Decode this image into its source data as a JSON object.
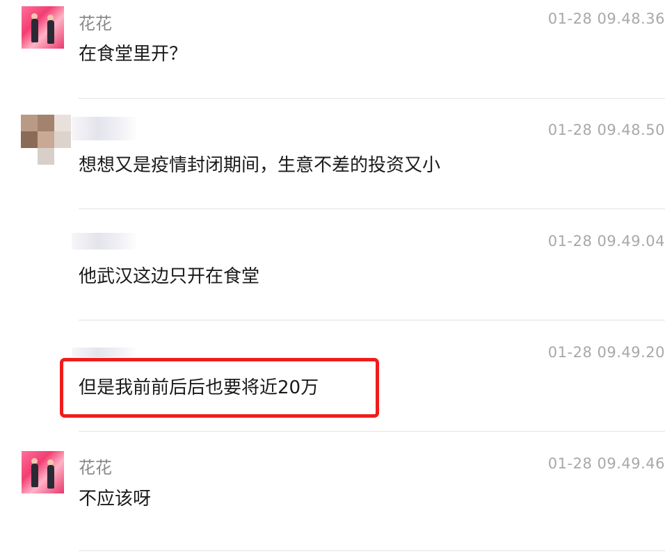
{
  "messages": [
    {
      "sender": "花花",
      "time": "01-28 09.48.36",
      "text": "在食堂里开？"
    },
    {
      "sender": "",
      "time": "01-28 09.48.50",
      "text": "想想又是疫情封闭期间，生意不差的投资又小"
    },
    {
      "sender": "",
      "time": "01-28 09.49.04",
      "text": "他武汉这边只开在食堂"
    },
    {
      "sender": "",
      "time": "01-28 09.49.20",
      "text": "但是我前前后后也要将近20万"
    },
    {
      "sender": "花花",
      "time": "01-28 09.49.46",
      "text": "不应该呀"
    }
  ],
  "colors": {
    "highlight": "#f01c1c",
    "timestamp": "#a8a8a8",
    "sender_name": "#8a8a8a",
    "message_text": "#1a1a1a",
    "divider": "#e2e2e2"
  },
  "icons": {
    "avatar_huahua": "avatar-photo-icon",
    "avatar_blurred": "avatar-mosaic-icon"
  }
}
